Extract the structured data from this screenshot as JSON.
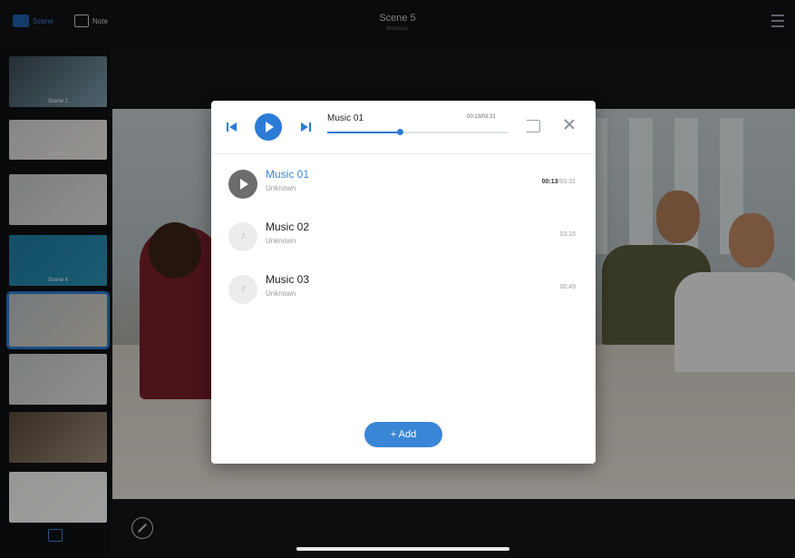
{
  "topbar": {
    "scene_tab": "Scene",
    "note_tab": "Note",
    "scene_title": "Scene 5",
    "scene_subtitle": "Business"
  },
  "sidebar": {
    "thumbnails": [
      {
        "caption": "Scene 1",
        "colors": [
          "#3b4a54",
          "#7fa0b0"
        ]
      },
      {
        "caption": "Scene 2",
        "colors": [
          "#d9d9d6",
          "#f0eeea"
        ]
      },
      {
        "caption": "",
        "colors": [
          "#c9cdd0",
          "#e4e6e8"
        ]
      },
      {
        "caption": "Scene 4",
        "colors": [
          "#1f7fa6",
          "#2a95b8"
        ]
      },
      {
        "caption": "",
        "colors": [
          "#b9c4c8",
          "#e0d8cc"
        ],
        "active": true
      },
      {
        "caption": "",
        "colors": [
          "#c9cdd0",
          "#e4e6e8"
        ]
      },
      {
        "caption": "",
        "colors": [
          "#5a4a3a",
          "#a09080"
        ]
      },
      {
        "caption": "",
        "colors": [
          "#f4f4f2",
          "#ffffff"
        ]
      }
    ]
  },
  "player": {
    "now_title": "Music 01",
    "now_time": "00:13/03:31",
    "progress": 0.4
  },
  "tracks": [
    {
      "name": "Music 01",
      "artist": "Unknown",
      "elapsed": "00:13",
      "duration": "/03:31",
      "playing": true
    },
    {
      "name": "Music 02",
      "artist": "Unknown",
      "elapsed": "",
      "duration": "03:15",
      "playing": false
    },
    {
      "name": "Music 03",
      "artist": "Unknown",
      "elapsed": "",
      "duration": "00:49",
      "playing": false
    }
  ],
  "add_label": "+ Add",
  "colors": {
    "accent": "#2b7bd6",
    "modal_bg": "#ffffff",
    "app_bg": "#141617"
  }
}
